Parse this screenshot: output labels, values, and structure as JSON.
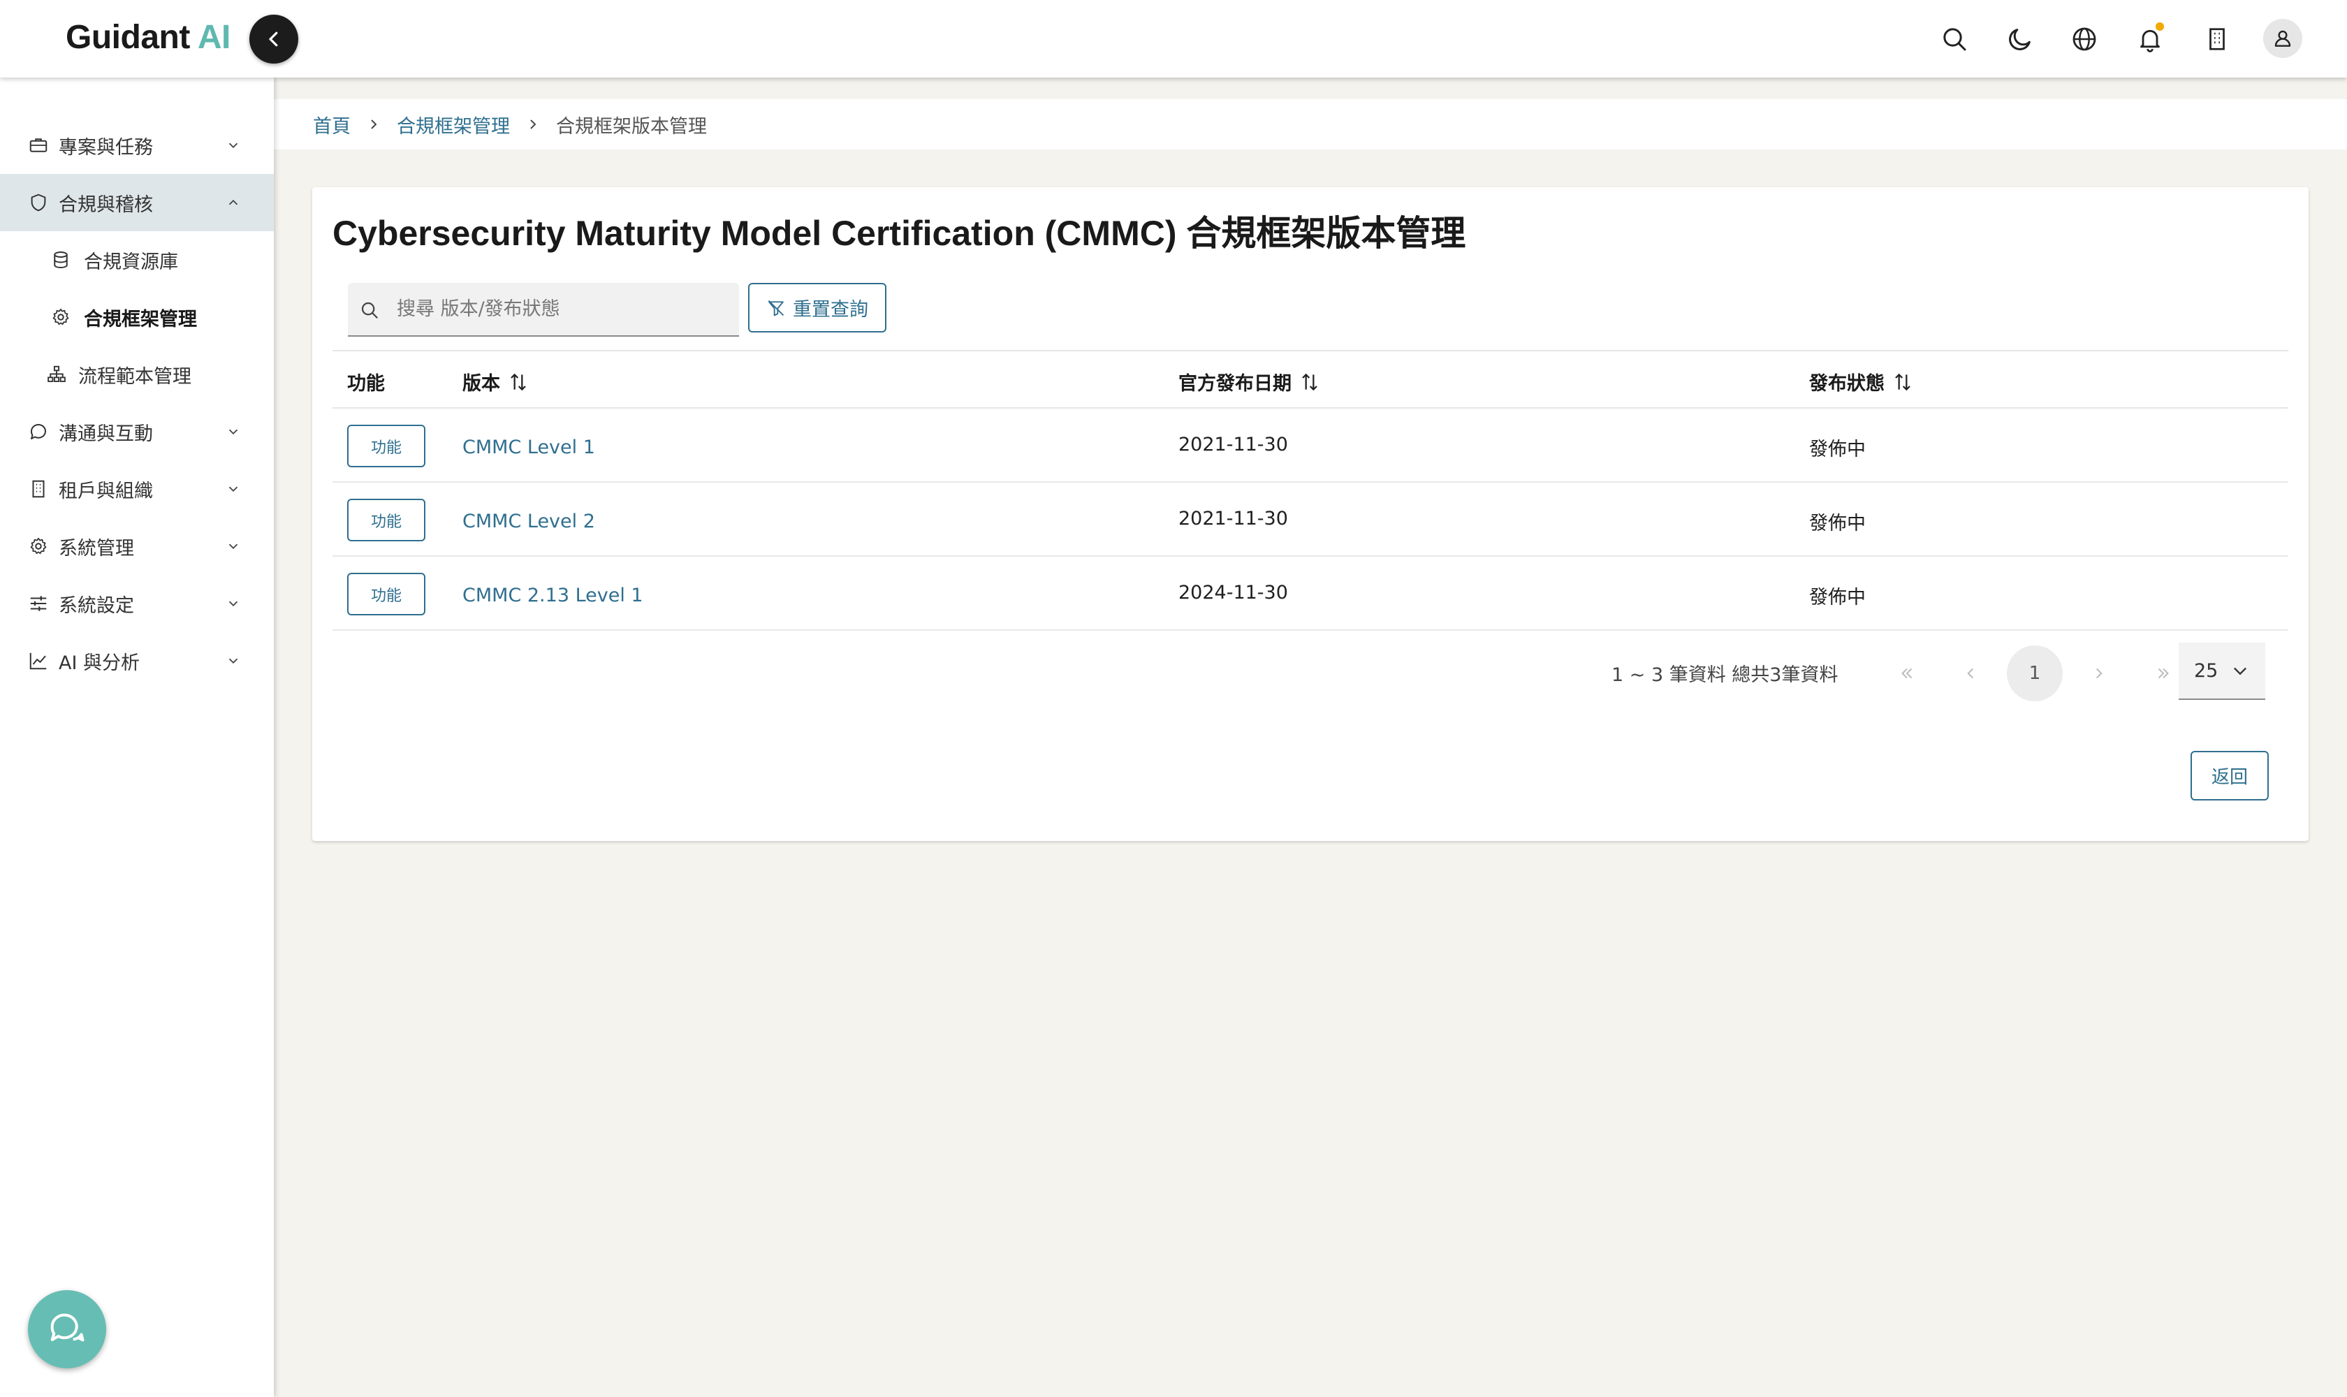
{
  "header": {
    "logo_main": "Guidant",
    "logo_accent": "AI",
    "icons": [
      "search-icon",
      "moon-icon",
      "globe-icon",
      "bell-icon",
      "building-icon",
      "user-icon"
    ],
    "notification_dot_color": "#f2a900"
  },
  "sidebar": {
    "items": [
      {
        "label": "專案與任務",
        "icon": "briefcase-icon"
      },
      {
        "label": "合規與稽核",
        "icon": "shield-icon",
        "expanded": true
      },
      {
        "label": "合規資源庫",
        "icon": "database-icon"
      },
      {
        "label": "合規框架管理",
        "icon": "gear-icon"
      },
      {
        "label": "流程範本管理",
        "icon": "hierarchy-icon"
      },
      {
        "label": "溝通與互動",
        "icon": "chat-icon"
      },
      {
        "label": "租戶與組織",
        "icon": "building-icon"
      },
      {
        "label": "系統管理",
        "icon": "gear-icon"
      },
      {
        "label": "系統設定",
        "icon": "sliders-icon"
      },
      {
        "label": "AI 與分析",
        "icon": "chart-icon"
      }
    ]
  },
  "breadcrumb": {
    "home": "首頁",
    "parent": "合規框架管理",
    "current": "合規框架版本管理"
  },
  "page": {
    "title": "Cybersecurity Maturity Model Certification (CMMC) 合規框架版本管理"
  },
  "search": {
    "placeholder": "搜尋 版本/發布狀態",
    "value": ""
  },
  "toolbar": {
    "reset_label": "重置查詢"
  },
  "table": {
    "columns": [
      "功能",
      "版本",
      "官方發布日期",
      "發布狀態"
    ],
    "action_label": "功能",
    "rows": [
      {
        "version": "CMMC Level 1",
        "date": "2021-11-30",
        "status": "發佈中"
      },
      {
        "version": "CMMC Level 2",
        "date": "2021-11-30",
        "status": "發佈中"
      },
      {
        "version": "CMMC 2.13 Level 1",
        "date": "2024-11-30",
        "status": "發佈中"
      }
    ]
  },
  "pagination": {
    "info": "1 ~ 3 筆資料 總共3筆資料",
    "current_page": "1",
    "page_size": "25"
  },
  "actions": {
    "back_label": "返回"
  },
  "colors": {
    "accent": "#2f6f8f",
    "brand_teal": "#5fb8b0",
    "fab": "#66bdb3",
    "active_nav": "#dfe6e9",
    "page_bg": "#f5f3ee"
  }
}
